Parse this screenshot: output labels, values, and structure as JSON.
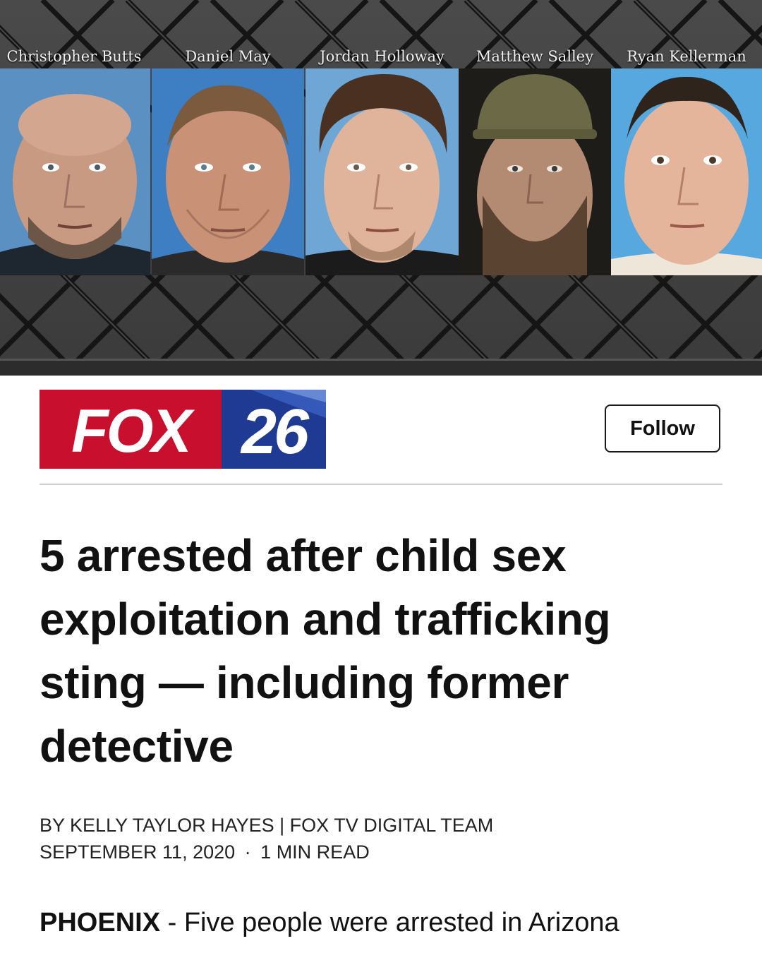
{
  "hero": {
    "people": [
      {
        "name": "Christopher Butts"
      },
      {
        "name": "Daniel May"
      },
      {
        "name": "Jordan Holloway"
      },
      {
        "name": "Matthew Salley"
      },
      {
        "name": "Ryan Kellerman"
      }
    ]
  },
  "brand": {
    "logo_word": "FOX",
    "logo_number": "26",
    "follow_label": "Follow",
    "red": "#c8102e",
    "blue": "#1f3a93"
  },
  "article": {
    "headline": "5 arrested after child sex exploitation and trafficking sting — including former detective",
    "byline": "BY KELLY TAYLOR HAYES | FOX TV DIGITAL TEAM",
    "date": "SEPTEMBER 11, 2020",
    "separator": "·",
    "read_time": "1 MIN READ",
    "dateline": "PHOENIX",
    "lead": " - Five people were arrested in Arizona"
  }
}
